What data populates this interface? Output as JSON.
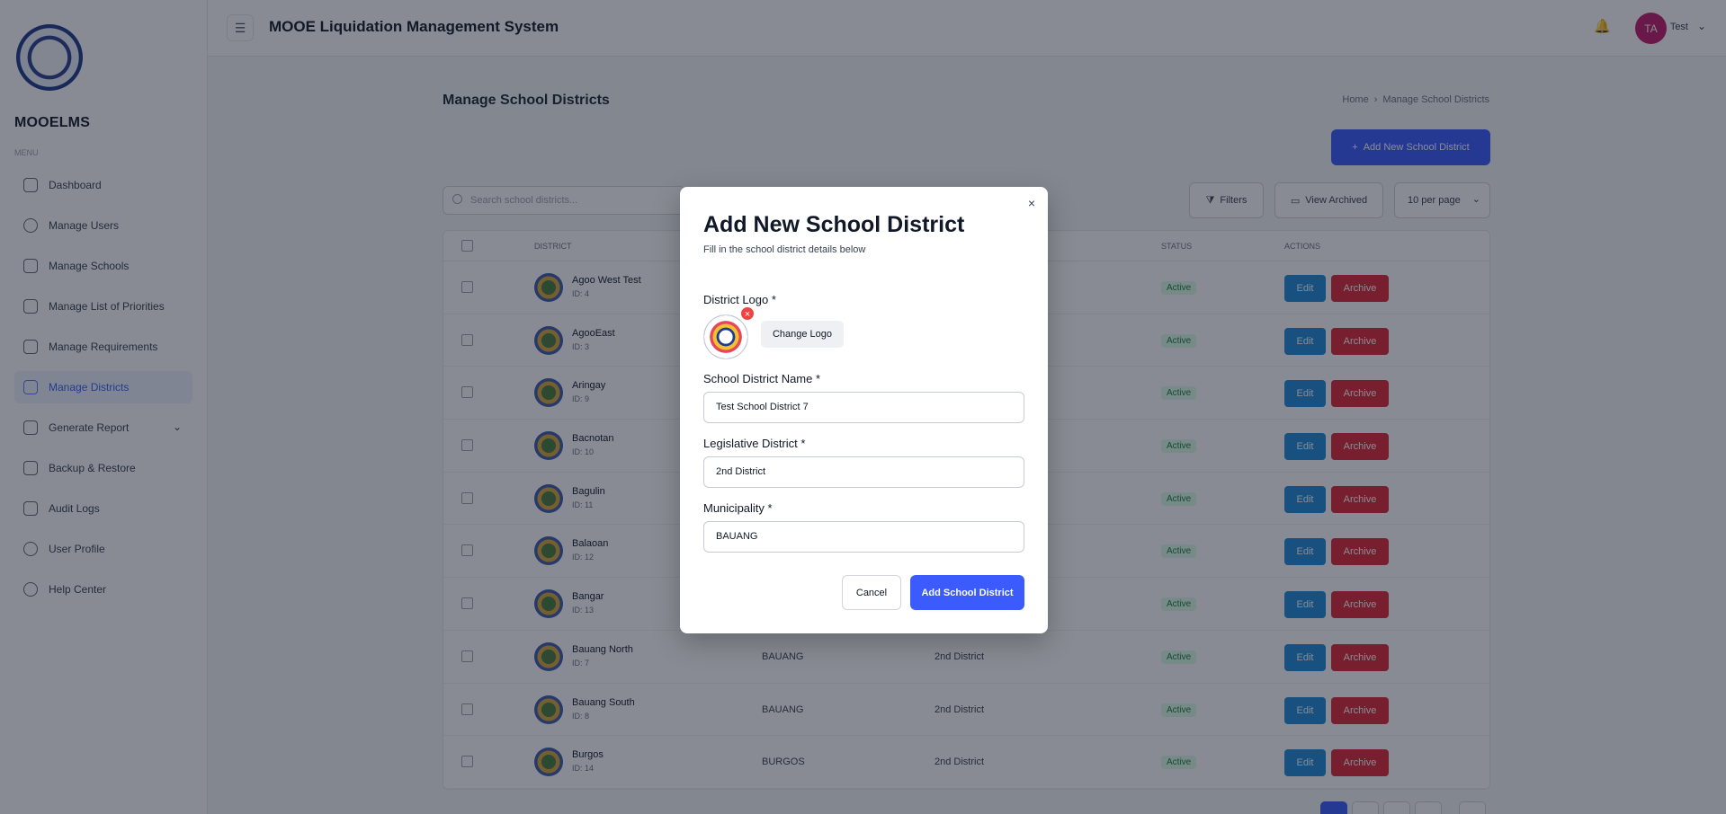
{
  "brand": {
    "name": "MOOELMS",
    "menu_label": "MENU"
  },
  "sidebar": {
    "items": [
      {
        "label": "Dashboard",
        "icon": "grid-icon"
      },
      {
        "label": "Manage Users",
        "icon": "user-icon"
      },
      {
        "label": "Manage Schools",
        "icon": "building-icon"
      },
      {
        "label": "Manage List of Priorities",
        "icon": "list-icon"
      },
      {
        "label": "Manage Requirements",
        "icon": "file-icon"
      },
      {
        "label": "Manage Districts",
        "icon": "map-icon",
        "active": true
      },
      {
        "label": "Generate Report",
        "icon": "report-icon"
      },
      {
        "label": "Backup & Restore",
        "icon": "database-icon"
      },
      {
        "label": "Audit Logs",
        "icon": "log-icon"
      },
      {
        "label": "User Profile",
        "icon": "profile-icon"
      },
      {
        "label": "Help Center",
        "icon": "help-icon"
      }
    ]
  },
  "header": {
    "title": "MOOE Liquidation Management System",
    "user_initials": "TA",
    "user_name": "Test"
  },
  "page": {
    "title": "Manage School Districts",
    "breadcrumb_home": "Home",
    "breadcrumb_current": "Manage School Districts",
    "add_button": "Add New School District",
    "search_placeholder": "Search school districts...",
    "filters_label": "Filters",
    "archived_label": "View Archived",
    "per_page": "10 per page"
  },
  "table": {
    "headers": {
      "district": "DISTRICT",
      "status": "STATUS",
      "actions": "ACTIONS"
    },
    "edit_label": "Edit",
    "archive_label": "Archive",
    "rows": [
      {
        "name": "Agoo West Test",
        "id": "ID: 4",
        "municipality": "",
        "legislative": "",
        "status": "Active"
      },
      {
        "name": "AgooEast",
        "id": "ID: 3",
        "municipality": "",
        "legislative": "",
        "status": "Active"
      },
      {
        "name": "Aringay",
        "id": "ID: 9",
        "municipality": "",
        "legislative": "",
        "status": "Active"
      },
      {
        "name": "Bacnotan",
        "id": "ID: 10",
        "municipality": "",
        "legislative": "",
        "status": "Active"
      },
      {
        "name": "Bagulin",
        "id": "ID: 11",
        "municipality": "",
        "legislative": "",
        "status": "Active"
      },
      {
        "name": "Balaoan",
        "id": "ID: 12",
        "municipality": "",
        "legislative": "",
        "status": "Active"
      },
      {
        "name": "Bangar",
        "id": "ID: 13",
        "municipality": "",
        "legislative": "",
        "status": "Active"
      },
      {
        "name": "Bauang North",
        "id": "ID: 7",
        "municipality": "BAUANG",
        "legislative": "2nd District",
        "status": "Active"
      },
      {
        "name": "Bauang South",
        "id": "ID: 8",
        "municipality": "BAUANG",
        "legislative": "2nd District",
        "status": "Active"
      },
      {
        "name": "Burgos",
        "id": "ID: 14",
        "municipality": "BURGOS",
        "legislative": "2nd District",
        "status": "Active"
      }
    ]
  },
  "modal": {
    "title": "Add New School District",
    "subtitle": "Fill in the school district details below",
    "logo_label": "District Logo *",
    "change_logo": "Change Logo",
    "name_label": "School District Name *",
    "name_value": "Test School District 7",
    "legislative_label": "Legislative District *",
    "legislative_value": "2nd District",
    "municipality_label": "Municipality *",
    "municipality_value": "BAUANG",
    "cancel": "Cancel",
    "submit": "Add School District",
    "close_icon": "×",
    "remove_icon": "×"
  },
  "colors": {
    "accent": "#3b5bfd",
    "edit": "#1e88d6",
    "archive": "#dc2637",
    "status_active": "#15803d"
  }
}
